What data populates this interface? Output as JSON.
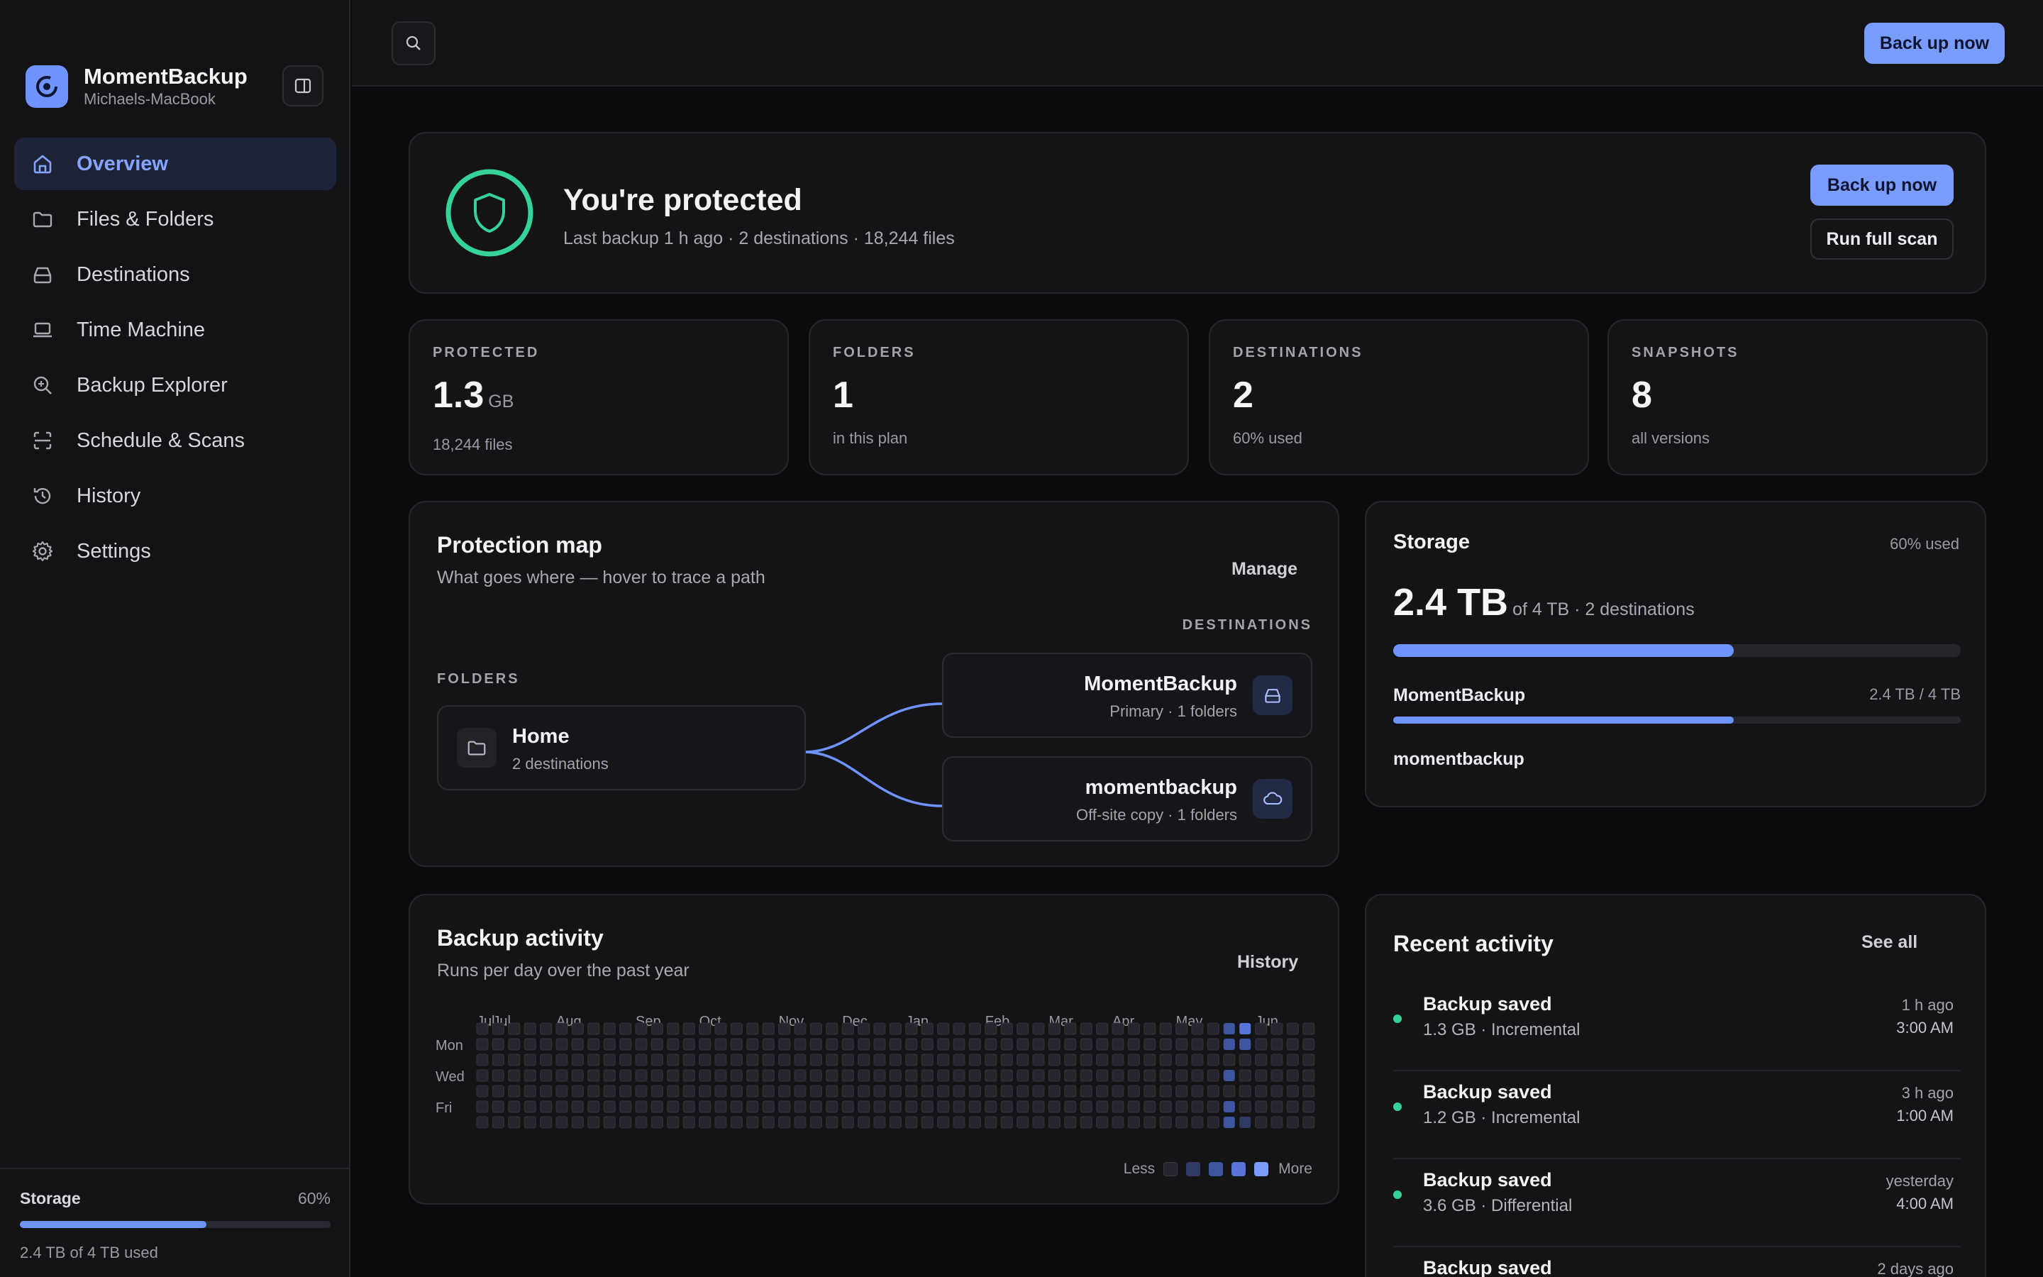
{
  "app": {
    "name": "MomentBackup",
    "device": "Michaels-MacBook"
  },
  "colors": {
    "accent": "#7b9cff",
    "success": "#36d399",
    "background": "#0b0b0d",
    "panel": "#141417"
  },
  "sidebar": {
    "items": [
      {
        "label": "Overview",
        "icon": "home-icon",
        "active": true
      },
      {
        "label": "Files & Folders",
        "icon": "folder-icon",
        "active": false
      },
      {
        "label": "Destinations",
        "icon": "drive-icon",
        "active": false
      },
      {
        "label": "Time Machine",
        "icon": "laptop-icon",
        "active": false
      },
      {
        "label": "Backup Explorer",
        "icon": "zoom-icon",
        "active": false
      },
      {
        "label": "Schedule & Scans",
        "icon": "scan-icon",
        "active": false
      },
      {
        "label": "History",
        "icon": "history-icon",
        "active": false
      },
      {
        "label": "Settings",
        "icon": "gear-icon",
        "active": false
      }
    ],
    "storage": {
      "title": "Storage",
      "percent_label": "60%",
      "fraction": 0.6,
      "summary": "2.4 TB of 4 TB used"
    }
  },
  "topbar": {
    "backup_label": "Back up now"
  },
  "hero": {
    "title": "You're protected",
    "subtitle": "Last backup 1 h ago · 2 destinations · 18,244 files",
    "backup_label": "Back up now",
    "scan_label": "Run full scan"
  },
  "stats": [
    {
      "label": "PROTECTED",
      "value": "1.3",
      "unit": "GB",
      "sub": "18,244 files"
    },
    {
      "label": "FOLDERS",
      "value": "1",
      "unit": "",
      "sub": "in this plan"
    },
    {
      "label": "DESTINATIONS",
      "value": "2",
      "unit": "",
      "sub": "60% used"
    },
    {
      "label": "SNAPSHOTS",
      "value": "8",
      "unit": "",
      "sub": "all versions"
    }
  ],
  "protection_map": {
    "title": "Protection map",
    "subtitle": "What goes where — hover to trace a path",
    "manage_label": "Manage",
    "folders_label": "FOLDERS",
    "destinations_label": "DESTINATIONS",
    "folder": {
      "name": "Home",
      "sub": "2 destinations"
    },
    "destinations": [
      {
        "name": "MomentBackup",
        "sub": "Primary · 1 folders",
        "icon": "drive-icon"
      },
      {
        "name": "momentbackup",
        "sub": "Off-site copy · 1 folders",
        "icon": "cloud-icon"
      }
    ]
  },
  "storage": {
    "title": "Storage",
    "used_label": "60% used",
    "total_value": "2.4 TB",
    "total_of": "of 4 TB · 2 destinations",
    "fraction": 0.6,
    "destinations": [
      {
        "name": "MomentBackup",
        "value": "2.4 TB / 4 TB",
        "fraction": 0.6
      },
      {
        "name": "momentbackup",
        "value": "",
        "fraction": null
      }
    ]
  },
  "activity": {
    "title": "Backup activity",
    "subtitle": "Runs per day over the past year",
    "history_label": "History",
    "months": [
      "Jul",
      "Jul",
      "Aug",
      "Sep",
      "Oct",
      "Nov",
      "Dec",
      "Jan",
      "Feb",
      "Mar",
      "Apr",
      "May",
      "Jun"
    ],
    "days": [
      "Mon",
      "Wed",
      "Fri"
    ],
    "legend_less": "Less",
    "legend_more": "More",
    "levels": [
      "#26262e",
      "#2f3b63",
      "#3f55a0",
      "#5876d8",
      "#7b9cff"
    ],
    "active_cells": [
      {
        "week": 47,
        "day": 0,
        "level": 2
      },
      {
        "week": 48,
        "day": 0,
        "level": 3
      },
      {
        "week": 47,
        "day": 1,
        "level": 2
      },
      {
        "week": 48,
        "day": 1,
        "level": 2
      },
      {
        "week": 47,
        "day": 3,
        "level": 2
      },
      {
        "week": 47,
        "day": 5,
        "level": 2
      },
      {
        "week": 47,
        "day": 6,
        "level": 2
      },
      {
        "week": 48,
        "day": 6,
        "level": 1
      }
    ]
  },
  "recent": {
    "title": "Recent activity",
    "see_all_label": "See all",
    "items": [
      {
        "title": "Backup saved",
        "sub": "1.3 GB · Incremental",
        "when": "1 h ago",
        "time": "3:00 AM"
      },
      {
        "title": "Backup saved",
        "sub": "1.2 GB · Incremental",
        "when": "3 h ago",
        "time": "1:00 AM"
      },
      {
        "title": "Backup saved",
        "sub": "3.6 GB · Differential",
        "when": "yesterday",
        "time": "4:00 AM"
      },
      {
        "title": "Backup saved",
        "sub": "",
        "when": "2 days ago",
        "time": ""
      }
    ]
  }
}
